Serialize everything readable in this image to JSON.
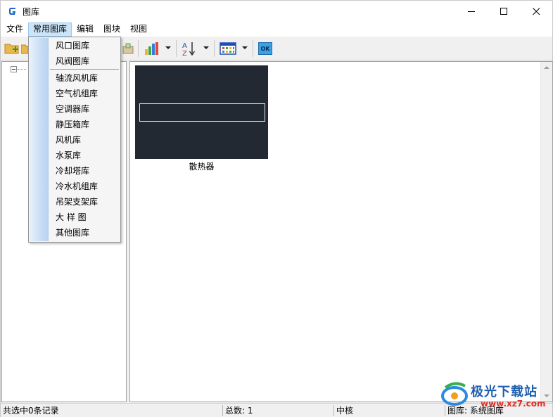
{
  "window": {
    "title": "图库"
  },
  "menubar": {
    "items": [
      "文件",
      "常用图库",
      "编辑",
      "图块",
      "视图"
    ]
  },
  "dropdown": {
    "items": [
      "风口图库",
      "风阀图库",
      "轴流风机库",
      "空气机组库",
      "空调器库",
      "静压箱库",
      "风机库",
      "水泵库",
      "冷却塔库",
      "冷水机组库",
      "吊架支架库",
      "大 样 图",
      "其他图库"
    ]
  },
  "toolbar": {
    "ok_label": "OK",
    "icons": [
      "add-folder-icon",
      "folder-icon",
      "import-icon",
      "bar-chart-icon",
      "sort-az-icon",
      "view-grid-icon",
      "ok-icon"
    ]
  },
  "content": {
    "items": [
      {
        "label": "散热器"
      }
    ]
  },
  "statusbar": {
    "selection": "共选中0条记录",
    "total": "总数: 1",
    "status": "中核",
    "library": "图库: 系统图库"
  },
  "watermark": {
    "text": "极光下载站",
    "url": "www.xz7.com"
  },
  "colors": {
    "thumb_bg": "#232933",
    "menu_highlight": "#cce4f7",
    "gutter": "#c9def5"
  }
}
